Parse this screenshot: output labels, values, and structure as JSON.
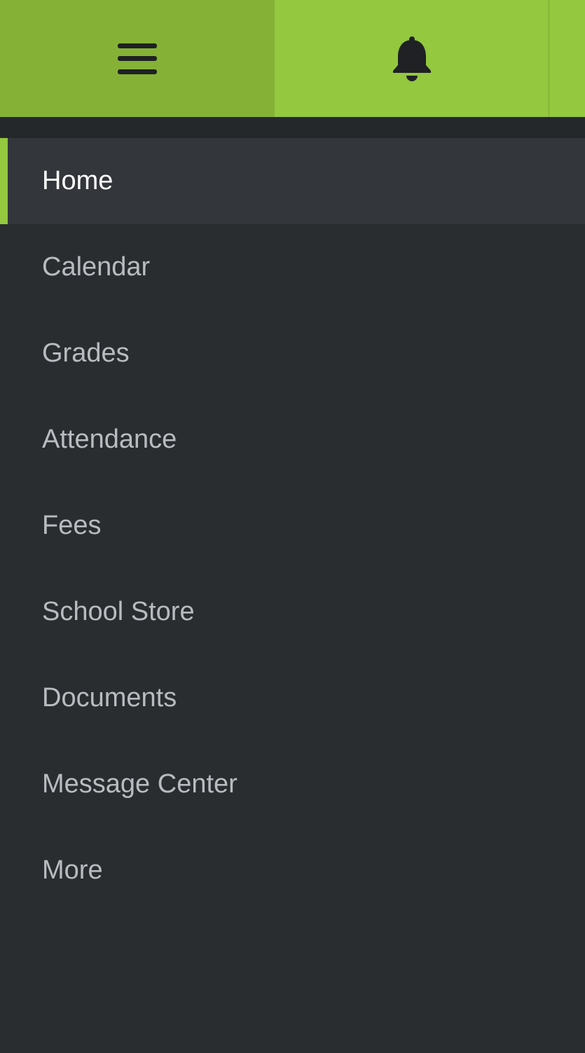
{
  "header": {
    "menu_icon": "hamburger-menu-icon",
    "notifications_icon": "bell-icon",
    "colors": {
      "menu_bg": "#85b236",
      "accent": "#93c83f"
    }
  },
  "sidebar": {
    "background": "#2a2d30",
    "active_index": 0,
    "items": [
      {
        "label": "Home"
      },
      {
        "label": "Calendar"
      },
      {
        "label": "Grades"
      },
      {
        "label": "Attendance"
      },
      {
        "label": "Fees"
      },
      {
        "label": "School Store"
      },
      {
        "label": "Documents"
      },
      {
        "label": "Message Center"
      },
      {
        "label": "More"
      }
    ]
  }
}
